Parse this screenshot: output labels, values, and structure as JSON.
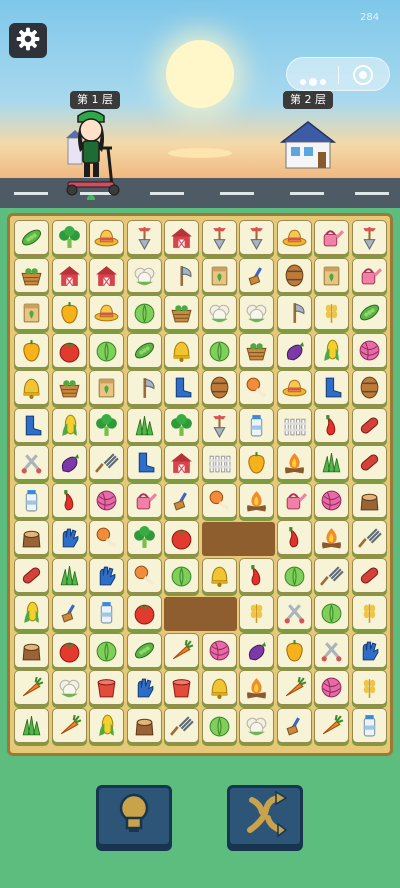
{
  "status": {
    "top_right_number": "284"
  },
  "colors": {
    "background": "#5dbd7e",
    "board": "#e6c878",
    "tile": "#f7f3d6",
    "button": "#2c5577"
  },
  "floors": {
    "current_label": "第 1 层",
    "next_label": "第 2 层"
  },
  "icons": {
    "settings": "gear-icon",
    "menu": "more-dots-icon",
    "close": "target-circle-icon",
    "hint": "lightbulb-icon",
    "shuffle": "shuffle-arrows-icon"
  },
  "board": {
    "columns": 10,
    "rows": 14,
    "empty_cells": [
      [
        8,
        5
      ],
      [
        8,
        6
      ],
      [
        10,
        4
      ],
      [
        10,
        5
      ]
    ],
    "tiles": [
      [
        "pea",
        "broccoli",
        "straw-hat",
        "shovel",
        "barn",
        "shovel",
        "shovel",
        "straw-hat",
        "watering-can",
        "shovel"
      ],
      [
        "basket",
        "barn",
        "barn",
        "cauliflower",
        "axe",
        "seed-bag",
        "brush",
        "barrel",
        "seed-bag",
        "watering-can"
      ],
      [
        "seed-bag",
        "pepper",
        "straw-hat",
        "cabbage",
        "basket",
        "cauliflower",
        "cauliflower",
        "axe",
        "wheat",
        "pea"
      ],
      [
        "pepper",
        "tomato",
        "cabbage",
        "pea",
        "bell",
        "cabbage",
        "basket",
        "eggplant",
        "corn",
        "yarn"
      ],
      [
        "bell",
        "basket",
        "seed-bag",
        "axe",
        "boot",
        "barrel",
        "drumstick",
        "straw-hat",
        "boot",
        "barrel"
      ],
      [
        "boot",
        "corn",
        "broccoli",
        "grass",
        "broccoli",
        "shovel",
        "milk",
        "fence",
        "chili",
        "sausage"
      ],
      [
        "shears",
        "eggplant",
        "pitchfork",
        "boot",
        "barn",
        "fence",
        "pepper",
        "campfire",
        "grass",
        "sausage"
      ],
      [
        "milk",
        "chili",
        "yarn",
        "watering-can",
        "brush",
        "drumstick",
        "campfire",
        "watering-can",
        "yarn",
        "stump"
      ],
      [
        "stump",
        "glove",
        "drumstick",
        "broccoli",
        "tomato",
        "",
        "",
        "chili",
        "campfire",
        "pitchfork"
      ],
      [
        "sausage",
        "grass",
        "glove",
        "drumstick",
        "cabbage",
        "bell",
        "chili",
        "cabbage",
        "pitchfork",
        "sausage"
      ],
      [
        "corn",
        "brush",
        "milk",
        "tomato",
        "",
        "",
        "wheat",
        "shears",
        "cabbage",
        "wheat"
      ],
      [
        "stump",
        "tomato",
        "cabbage",
        "pea",
        "carrot",
        "yarn",
        "eggplant",
        "pepper",
        "shears",
        "glove"
      ],
      [
        "carrot",
        "cauliflower",
        "bucket",
        "glove",
        "bucket",
        "bell",
        "campfire",
        "carrot",
        "yarn",
        "wheat"
      ],
      [
        "grass",
        "carrot",
        "corn",
        "stump",
        "pitchfork",
        "cabbage",
        "cauliflower",
        "brush",
        "carrot",
        "milk"
      ]
    ]
  }
}
